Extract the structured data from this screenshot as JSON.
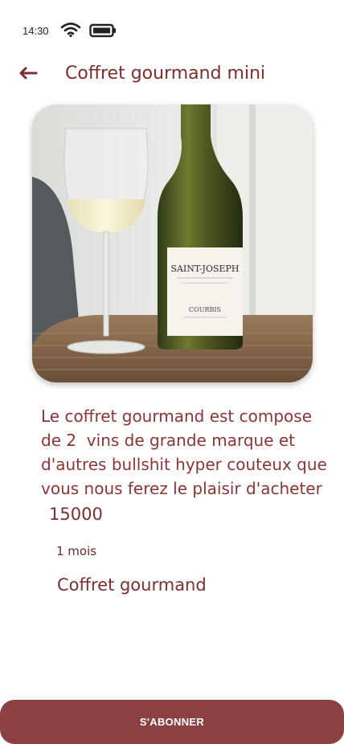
{
  "status_bar": {
    "time": "14:30",
    "icons": [
      "wifi-icon",
      "battery-icon"
    ]
  },
  "header": {
    "back_icon": "arrow-left-icon",
    "title": "Coffret gourmand mini"
  },
  "product": {
    "image": {
      "description_icon": "wine-bottle-and-glass-photo",
      "label_main": "SAINT-JOSEPH",
      "label_brand": "COURBIS"
    },
    "description": "Le coffret gourmand est compose\nde 2  vins de grande marque et\nd'autres bullshit hyper couteux que\nvous nous ferez le plaisir d'acheter",
    "price": "15000",
    "duration": "1 mois",
    "name": "Coffret gourmand"
  },
  "cta": {
    "label": "S'ABONNER"
  },
  "colors": {
    "accent": "#8b4141",
    "text": "#7a2e2e"
  }
}
